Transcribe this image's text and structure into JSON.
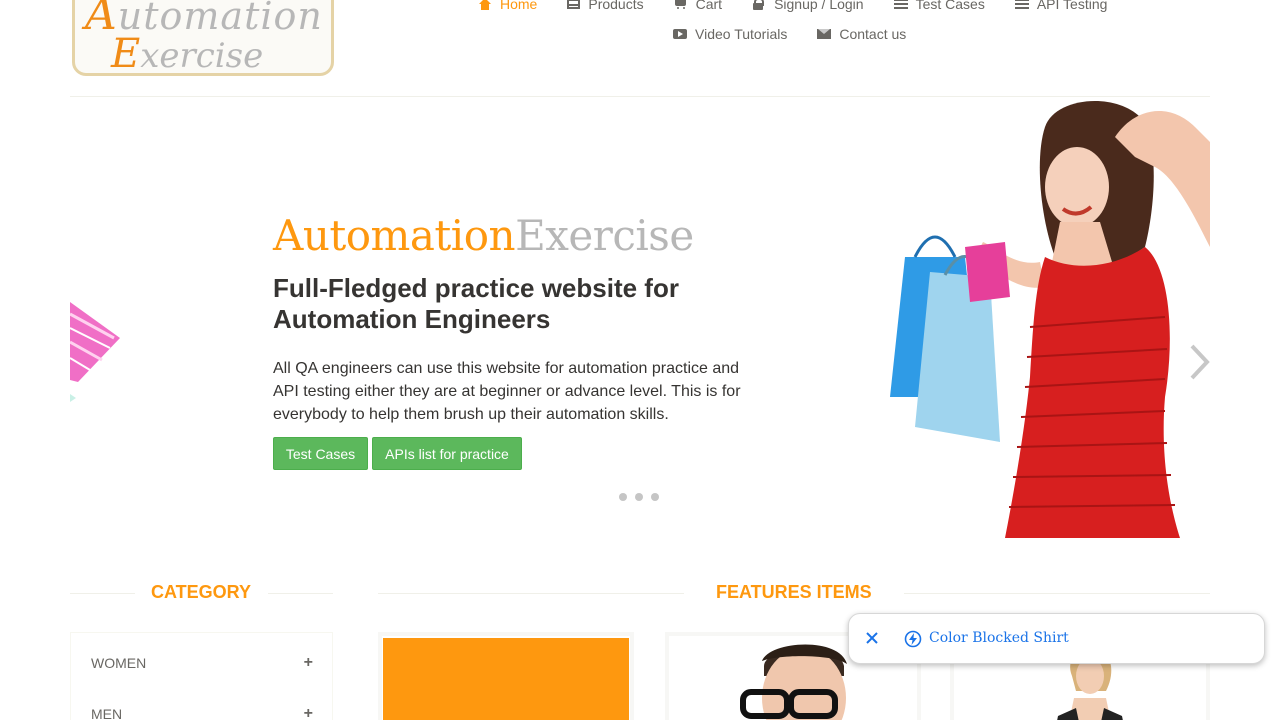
{
  "header": {
    "logo_line1": "Automation",
    "logo_line2": "Exercise",
    "nav": [
      {
        "label": "Home",
        "icon": "home-icon",
        "active": true
      },
      {
        "label": "Products",
        "icon": "products-icon"
      },
      {
        "label": "Cart",
        "icon": "cart-icon"
      },
      {
        "label": "Signup / Login",
        "icon": "lock-icon"
      },
      {
        "label": "Test Cases",
        "icon": "list-icon"
      },
      {
        "label": "API Testing",
        "icon": "list-icon"
      },
      {
        "label": "Video Tutorials",
        "icon": "video-icon"
      },
      {
        "label": "Contact us",
        "icon": "envelope-icon"
      }
    ]
  },
  "slider": {
    "brand_orange": "Automation",
    "brand_grey": "Exercise",
    "title": "Full-Fledged practice website for Automation Engineers",
    "description": "All QA engineers can use this website for automation practice and API testing either they are at beginner or advance level. This is for everybody to help them brush up their automation skills.",
    "buttons": [
      "Test Cases",
      "APIs list for practice"
    ],
    "slide_count": 3
  },
  "sections": {
    "category_title": "CATEGORY",
    "features_title": "FEATURES ITEMS",
    "categories": [
      "WOMEN",
      "MEN"
    ],
    "plus": "+"
  },
  "popup": {
    "text": "Color Blocked Shirt"
  },
  "colors": {
    "accent": "#fe980f",
    "button_green": "#5cb85c",
    "text": "#696763",
    "link_blue": "#1a73e8"
  }
}
